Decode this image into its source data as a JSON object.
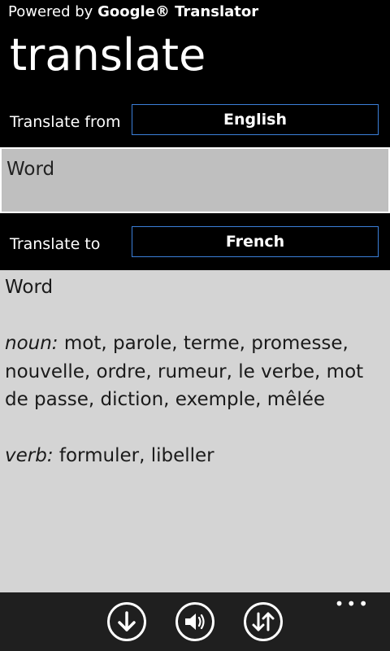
{
  "header": {
    "powered_prefix": "Powered by ",
    "powered_brand": "Google® Translator",
    "title": "translate"
  },
  "from": {
    "label": "Translate from",
    "language": "English"
  },
  "input": {
    "value": "Word"
  },
  "to": {
    "label": "Translate to",
    "language": "French"
  },
  "result": {
    "word": "Word",
    "entries": [
      {
        "pos": "noun:",
        "text": " mot, parole, terme, promesse, nouvelle, ordre, rumeur, le verbe, mot de passe, diction, exemple, mêlée"
      },
      {
        "pos": "verb:",
        "text": " formuler, libeller"
      }
    ]
  },
  "appbar": {
    "buttons": [
      "download-icon",
      "speaker-icon",
      "swap-icon"
    ],
    "more": "•••"
  },
  "colors": {
    "background": "#000000",
    "input_bg": "#bfbfbf",
    "result_bg": "#d4d4d4",
    "box_border": "#3b7fd9",
    "appbar_bg": "#1f1f1f"
  }
}
